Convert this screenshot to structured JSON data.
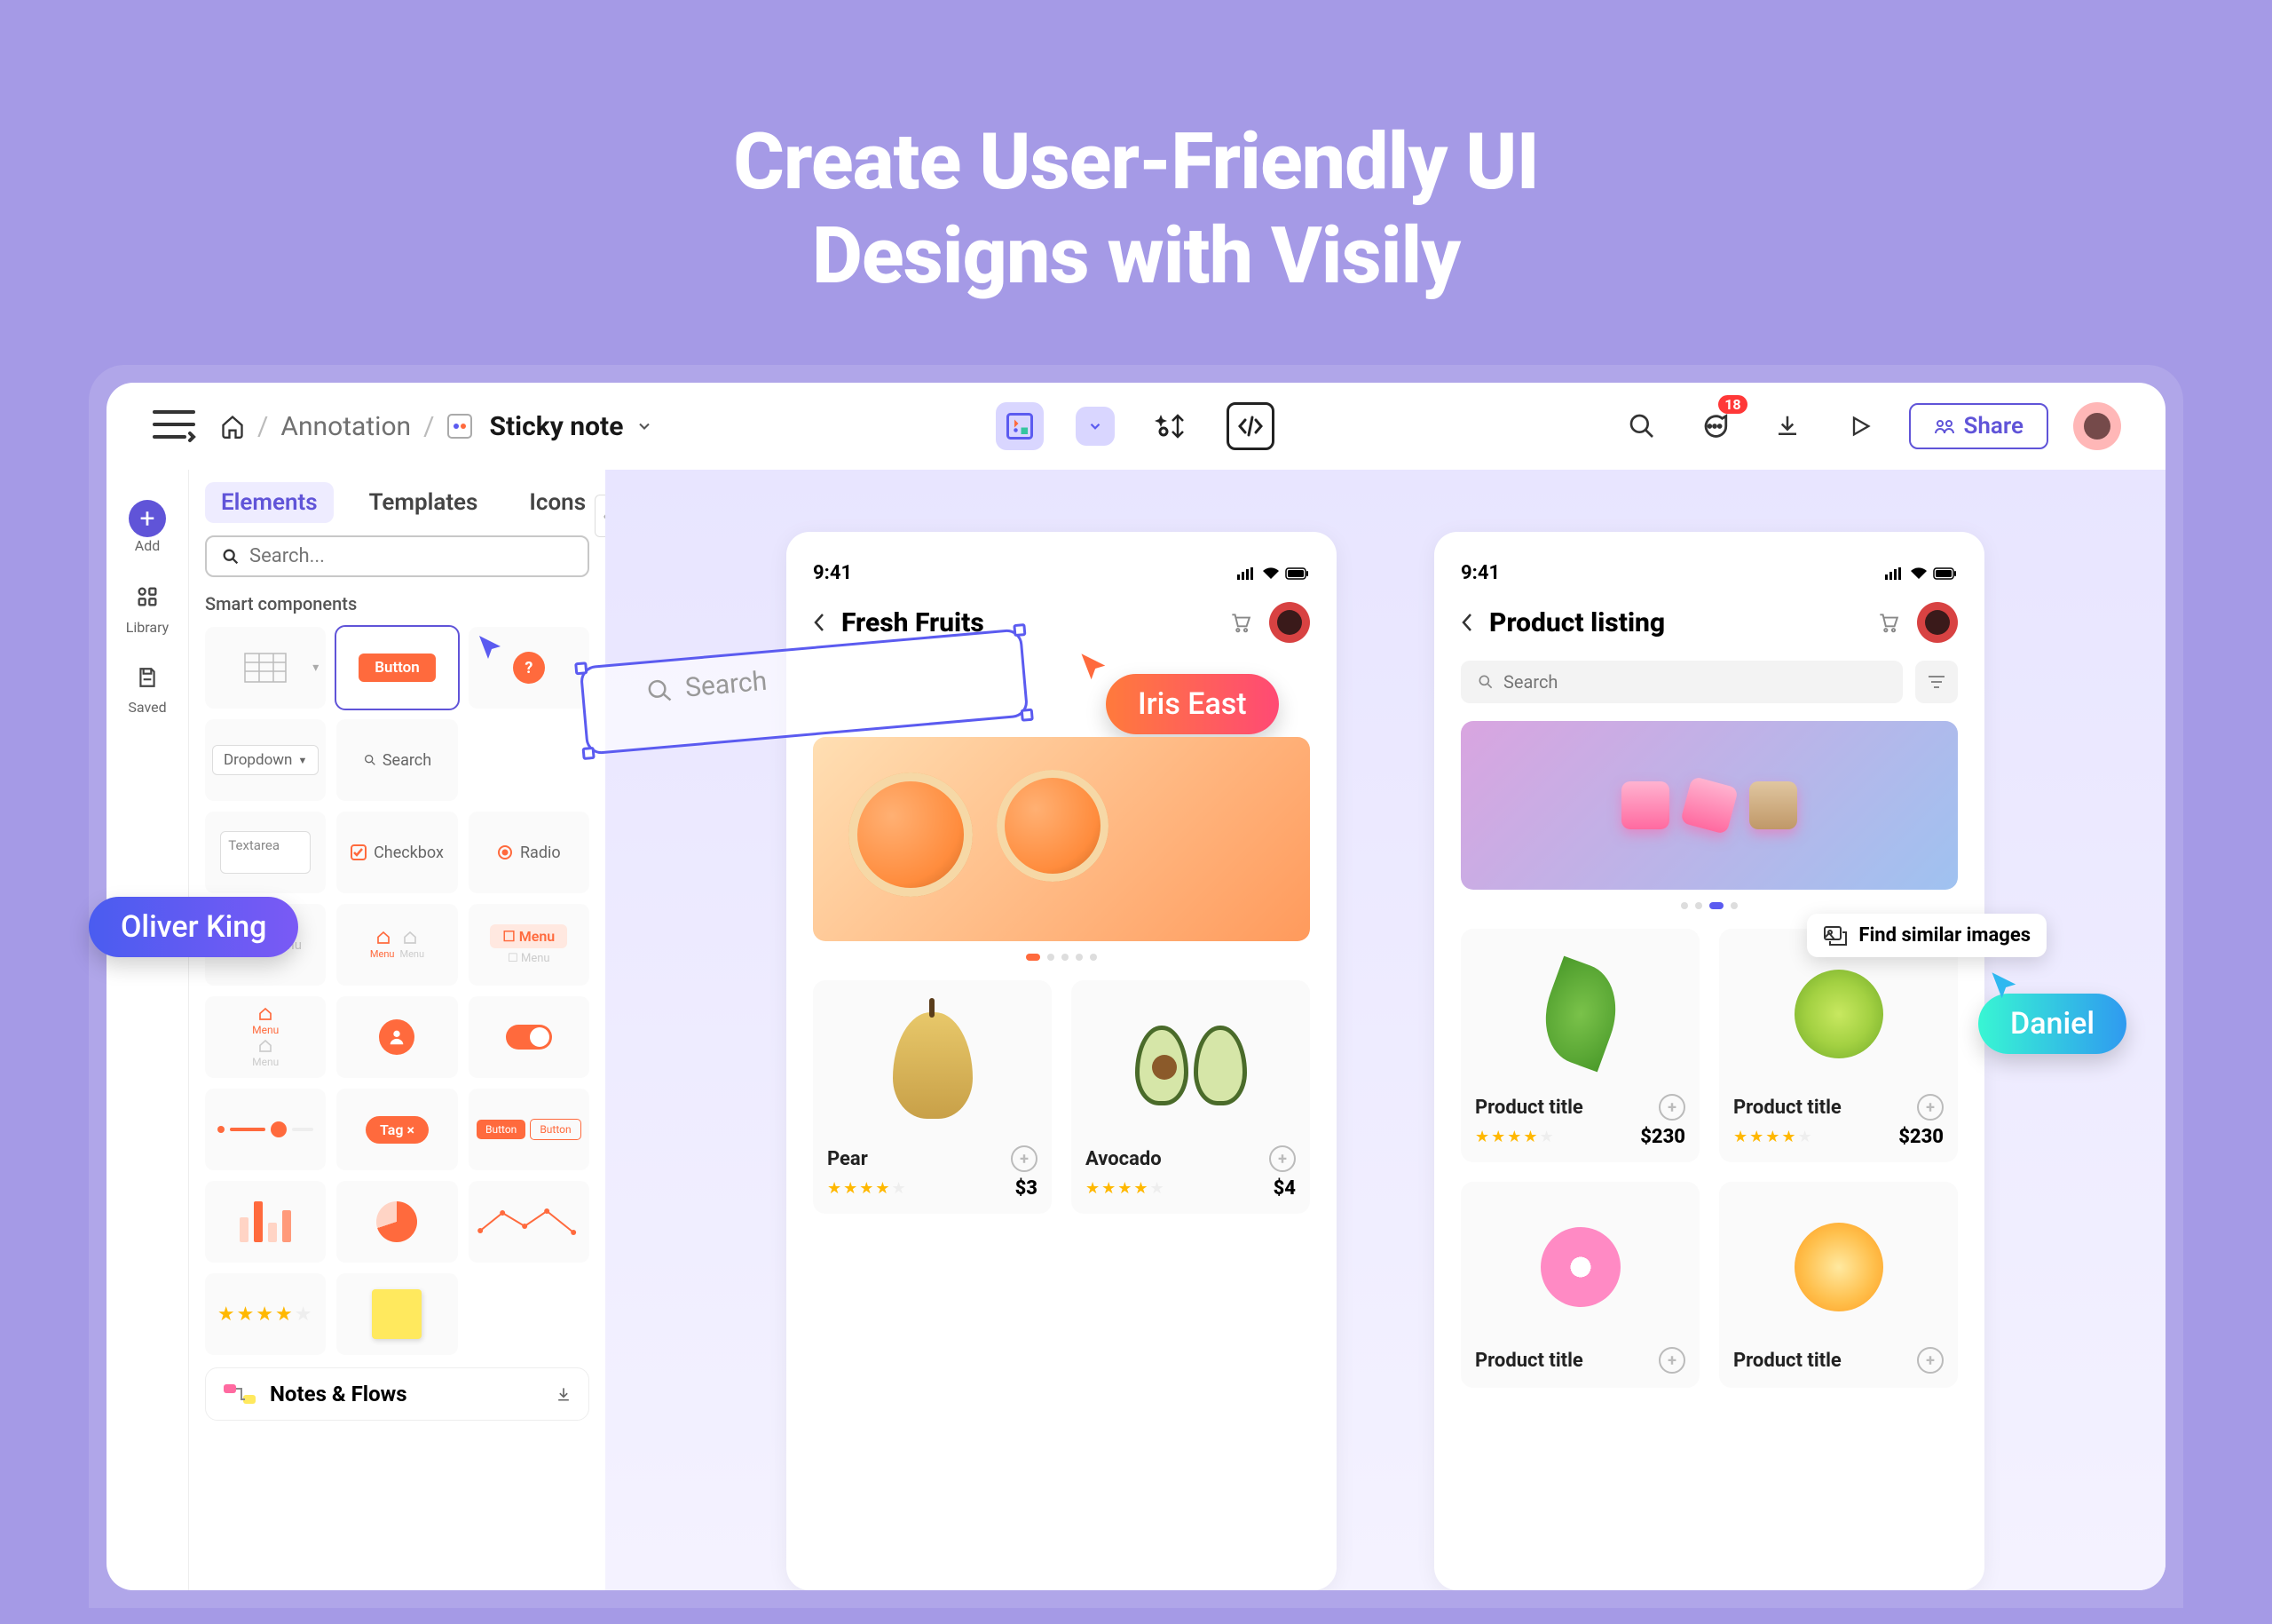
{
  "hero": {
    "line1": "Create User-Friendly UI",
    "line2": "Designs with Visily"
  },
  "breadcrumbs": {
    "root": "Annotation",
    "current": "Sticky note"
  },
  "topbar": {
    "notification_count": "18",
    "share_label": "Share"
  },
  "toolbar": {
    "add_label": "Add",
    "library_label": "Library",
    "saved_label": "Saved"
  },
  "panel": {
    "tabs": {
      "elements": "Elements",
      "templates": "Templates",
      "icons": "Icons"
    },
    "search_placeholder": "Search...",
    "section_smart": "Smart components",
    "button_label": "Button",
    "dropdown_label": "Dropdown",
    "search_comp": "Search",
    "textarea_label": "Textarea",
    "checkbox_label": "Checkbox",
    "radio_label": "Radio",
    "menu_label": "Menu",
    "tag_label": "Tag",
    "notes_label": "Notes & Flows"
  },
  "users": {
    "oliver": "Oliver King",
    "iris": "Iris East",
    "daniel": "Daniel"
  },
  "mock1": {
    "time": "9:41",
    "title": "Fresh Fruits",
    "search_placeholder": "Search",
    "products": [
      {
        "name": "Pear",
        "price": "$3"
      },
      {
        "name": "Avocado",
        "price": "$4"
      }
    ]
  },
  "mock2": {
    "time": "9:41",
    "title": "Product listing",
    "search_placeholder": "Search",
    "context_action": "Find similar images",
    "product_title": "Product title",
    "price": "$230"
  }
}
